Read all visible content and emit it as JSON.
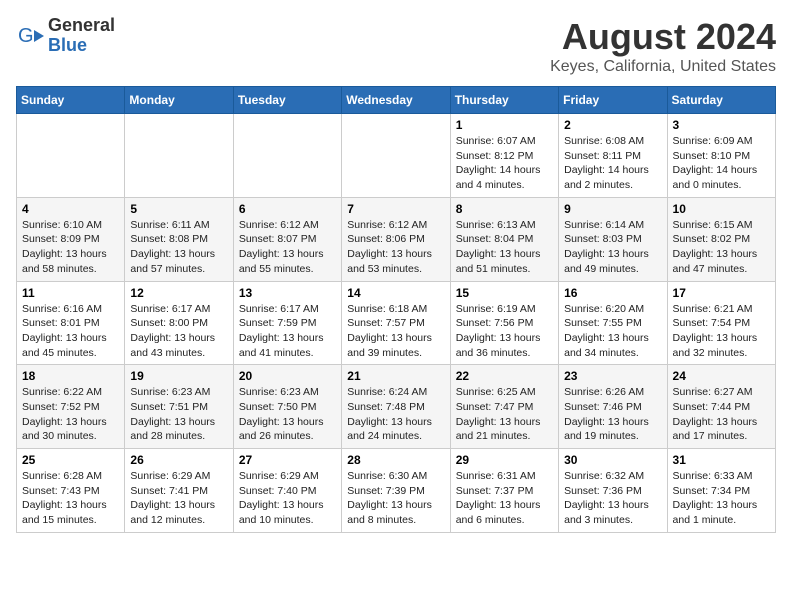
{
  "logo": {
    "general": "General",
    "blue": "Blue"
  },
  "title": "August 2024",
  "subtitle": "Keyes, California, United States",
  "weekdays": [
    "Sunday",
    "Monday",
    "Tuesday",
    "Wednesday",
    "Thursday",
    "Friday",
    "Saturday"
  ],
  "weeks": [
    [
      {
        "day": "",
        "info": ""
      },
      {
        "day": "",
        "info": ""
      },
      {
        "day": "",
        "info": ""
      },
      {
        "day": "",
        "info": ""
      },
      {
        "day": "1",
        "info": "Sunrise: 6:07 AM\nSunset: 8:12 PM\nDaylight: 14 hours\nand 4 minutes."
      },
      {
        "day": "2",
        "info": "Sunrise: 6:08 AM\nSunset: 8:11 PM\nDaylight: 14 hours\nand 2 minutes."
      },
      {
        "day": "3",
        "info": "Sunrise: 6:09 AM\nSunset: 8:10 PM\nDaylight: 14 hours\nand 0 minutes."
      }
    ],
    [
      {
        "day": "4",
        "info": "Sunrise: 6:10 AM\nSunset: 8:09 PM\nDaylight: 13 hours\nand 58 minutes."
      },
      {
        "day": "5",
        "info": "Sunrise: 6:11 AM\nSunset: 8:08 PM\nDaylight: 13 hours\nand 57 minutes."
      },
      {
        "day": "6",
        "info": "Sunrise: 6:12 AM\nSunset: 8:07 PM\nDaylight: 13 hours\nand 55 minutes."
      },
      {
        "day": "7",
        "info": "Sunrise: 6:12 AM\nSunset: 8:06 PM\nDaylight: 13 hours\nand 53 minutes."
      },
      {
        "day": "8",
        "info": "Sunrise: 6:13 AM\nSunset: 8:04 PM\nDaylight: 13 hours\nand 51 minutes."
      },
      {
        "day": "9",
        "info": "Sunrise: 6:14 AM\nSunset: 8:03 PM\nDaylight: 13 hours\nand 49 minutes."
      },
      {
        "day": "10",
        "info": "Sunrise: 6:15 AM\nSunset: 8:02 PM\nDaylight: 13 hours\nand 47 minutes."
      }
    ],
    [
      {
        "day": "11",
        "info": "Sunrise: 6:16 AM\nSunset: 8:01 PM\nDaylight: 13 hours\nand 45 minutes."
      },
      {
        "day": "12",
        "info": "Sunrise: 6:17 AM\nSunset: 8:00 PM\nDaylight: 13 hours\nand 43 minutes."
      },
      {
        "day": "13",
        "info": "Sunrise: 6:17 AM\nSunset: 7:59 PM\nDaylight: 13 hours\nand 41 minutes."
      },
      {
        "day": "14",
        "info": "Sunrise: 6:18 AM\nSunset: 7:57 PM\nDaylight: 13 hours\nand 39 minutes."
      },
      {
        "day": "15",
        "info": "Sunrise: 6:19 AM\nSunset: 7:56 PM\nDaylight: 13 hours\nand 36 minutes."
      },
      {
        "day": "16",
        "info": "Sunrise: 6:20 AM\nSunset: 7:55 PM\nDaylight: 13 hours\nand 34 minutes."
      },
      {
        "day": "17",
        "info": "Sunrise: 6:21 AM\nSunset: 7:54 PM\nDaylight: 13 hours\nand 32 minutes."
      }
    ],
    [
      {
        "day": "18",
        "info": "Sunrise: 6:22 AM\nSunset: 7:52 PM\nDaylight: 13 hours\nand 30 minutes."
      },
      {
        "day": "19",
        "info": "Sunrise: 6:23 AM\nSunset: 7:51 PM\nDaylight: 13 hours\nand 28 minutes."
      },
      {
        "day": "20",
        "info": "Sunrise: 6:23 AM\nSunset: 7:50 PM\nDaylight: 13 hours\nand 26 minutes."
      },
      {
        "day": "21",
        "info": "Sunrise: 6:24 AM\nSunset: 7:48 PM\nDaylight: 13 hours\nand 24 minutes."
      },
      {
        "day": "22",
        "info": "Sunrise: 6:25 AM\nSunset: 7:47 PM\nDaylight: 13 hours\nand 21 minutes."
      },
      {
        "day": "23",
        "info": "Sunrise: 6:26 AM\nSunset: 7:46 PM\nDaylight: 13 hours\nand 19 minutes."
      },
      {
        "day": "24",
        "info": "Sunrise: 6:27 AM\nSunset: 7:44 PM\nDaylight: 13 hours\nand 17 minutes."
      }
    ],
    [
      {
        "day": "25",
        "info": "Sunrise: 6:28 AM\nSunset: 7:43 PM\nDaylight: 13 hours\nand 15 minutes."
      },
      {
        "day": "26",
        "info": "Sunrise: 6:29 AM\nSunset: 7:41 PM\nDaylight: 13 hours\nand 12 minutes."
      },
      {
        "day": "27",
        "info": "Sunrise: 6:29 AM\nSunset: 7:40 PM\nDaylight: 13 hours\nand 10 minutes."
      },
      {
        "day": "28",
        "info": "Sunrise: 6:30 AM\nSunset: 7:39 PM\nDaylight: 13 hours\nand 8 minutes."
      },
      {
        "day": "29",
        "info": "Sunrise: 6:31 AM\nSunset: 7:37 PM\nDaylight: 13 hours\nand 6 minutes."
      },
      {
        "day": "30",
        "info": "Sunrise: 6:32 AM\nSunset: 7:36 PM\nDaylight: 13 hours\nand 3 minutes."
      },
      {
        "day": "31",
        "info": "Sunrise: 6:33 AM\nSunset: 7:34 PM\nDaylight: 13 hours\nand 1 minute."
      }
    ]
  ]
}
